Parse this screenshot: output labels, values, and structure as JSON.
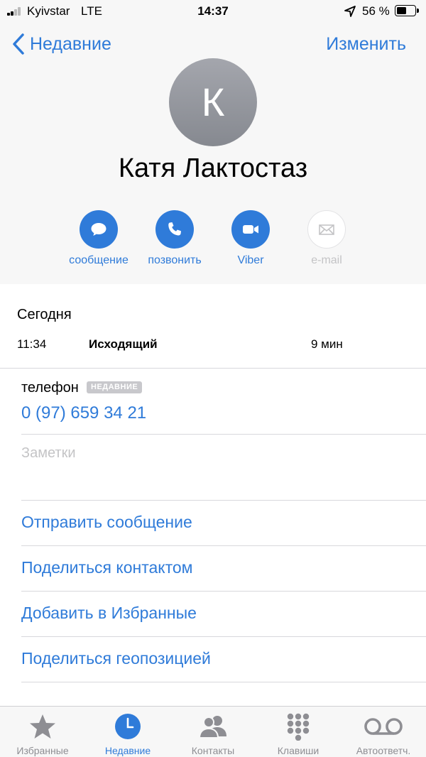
{
  "status_bar": {
    "carrier": "Kyivstar",
    "network": "LTE",
    "time": "14:37",
    "battery_percent": "56 %",
    "battery_level": 0.56
  },
  "nav": {
    "back_label": "Недавние",
    "edit_label": "Изменить"
  },
  "contact": {
    "initial": "К",
    "name": "Катя Лактостаз"
  },
  "actions": [
    {
      "label": "сообщение",
      "icon": "message-icon",
      "enabled": true
    },
    {
      "label": "позвонить",
      "icon": "phone-icon",
      "enabled": true
    },
    {
      "label": "Viber",
      "icon": "video-icon",
      "enabled": true
    },
    {
      "label": "e-mail",
      "icon": "mail-icon",
      "enabled": false
    }
  ],
  "recent_calls": {
    "day": "Сегодня",
    "calls": [
      {
        "time": "11:34",
        "type": "Исходящий",
        "duration": "9 мин"
      }
    ]
  },
  "phone": {
    "label": "телефон",
    "badge": "НЕДАВНИЕ",
    "number": "0 (97) 659 34 21"
  },
  "notes": {
    "placeholder": "Заметки"
  },
  "links": [
    "Отправить сообщение",
    "Поделиться контактом",
    "Добавить в Избранные",
    "Поделиться геопозицией"
  ],
  "tab_bar": {
    "tabs": [
      {
        "label": "Избранные",
        "icon": "star-icon",
        "active": false
      },
      {
        "label": "Недавние",
        "icon": "clock-icon",
        "active": true
      },
      {
        "label": "Контакты",
        "icon": "contacts-icon",
        "active": false
      },
      {
        "label": "Клавиши",
        "icon": "keypad-icon",
        "active": false
      },
      {
        "label": "Автоответч.",
        "icon": "voicemail-icon",
        "active": false
      }
    ]
  },
  "colors": {
    "accent": "#2f7bd9",
    "inactive": "#8e8e93",
    "disabled": "#c4c4c6"
  }
}
